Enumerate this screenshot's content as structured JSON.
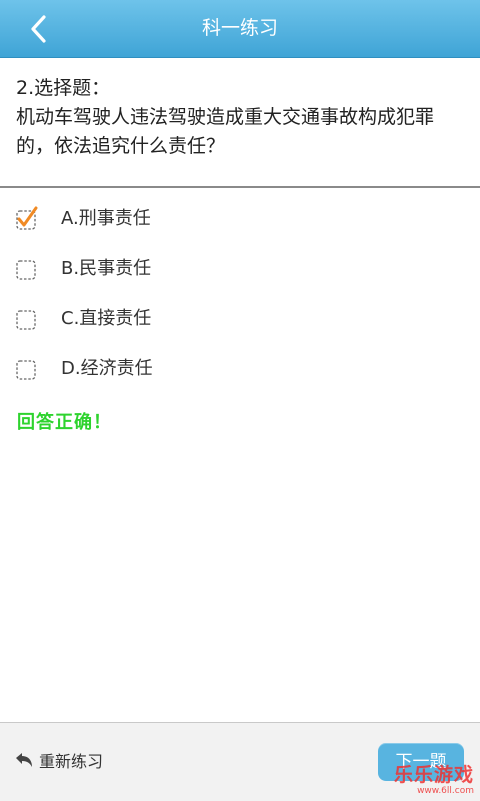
{
  "header": {
    "title": "科一练习",
    "back_icon": "chevron-left-icon"
  },
  "question": {
    "number": "2.选择题：",
    "text": "机动车驾驶人违法驾驶造成重大交通事故构成犯罪的，依法追究什么责任？"
  },
  "options": [
    {
      "label": "A.刑事责任",
      "checked": true
    },
    {
      "label": "B.民事责任",
      "checked": false
    },
    {
      "label": "C.直接责任",
      "checked": false
    },
    {
      "label": "D.经济责任",
      "checked": false
    }
  ],
  "result": {
    "text": "回答正确！",
    "color": "#2ed32e"
  },
  "footer": {
    "reset_label": "重新练习",
    "reset_icon": "undo-arrow-icon",
    "next_label": "下一题"
  },
  "watermark": {
    "main": "乐乐游戏",
    "sub": "www.6ll.com"
  },
  "colors": {
    "header": "#4fb2e0",
    "check": "#f08a24",
    "next_button": "#58b4e0"
  }
}
